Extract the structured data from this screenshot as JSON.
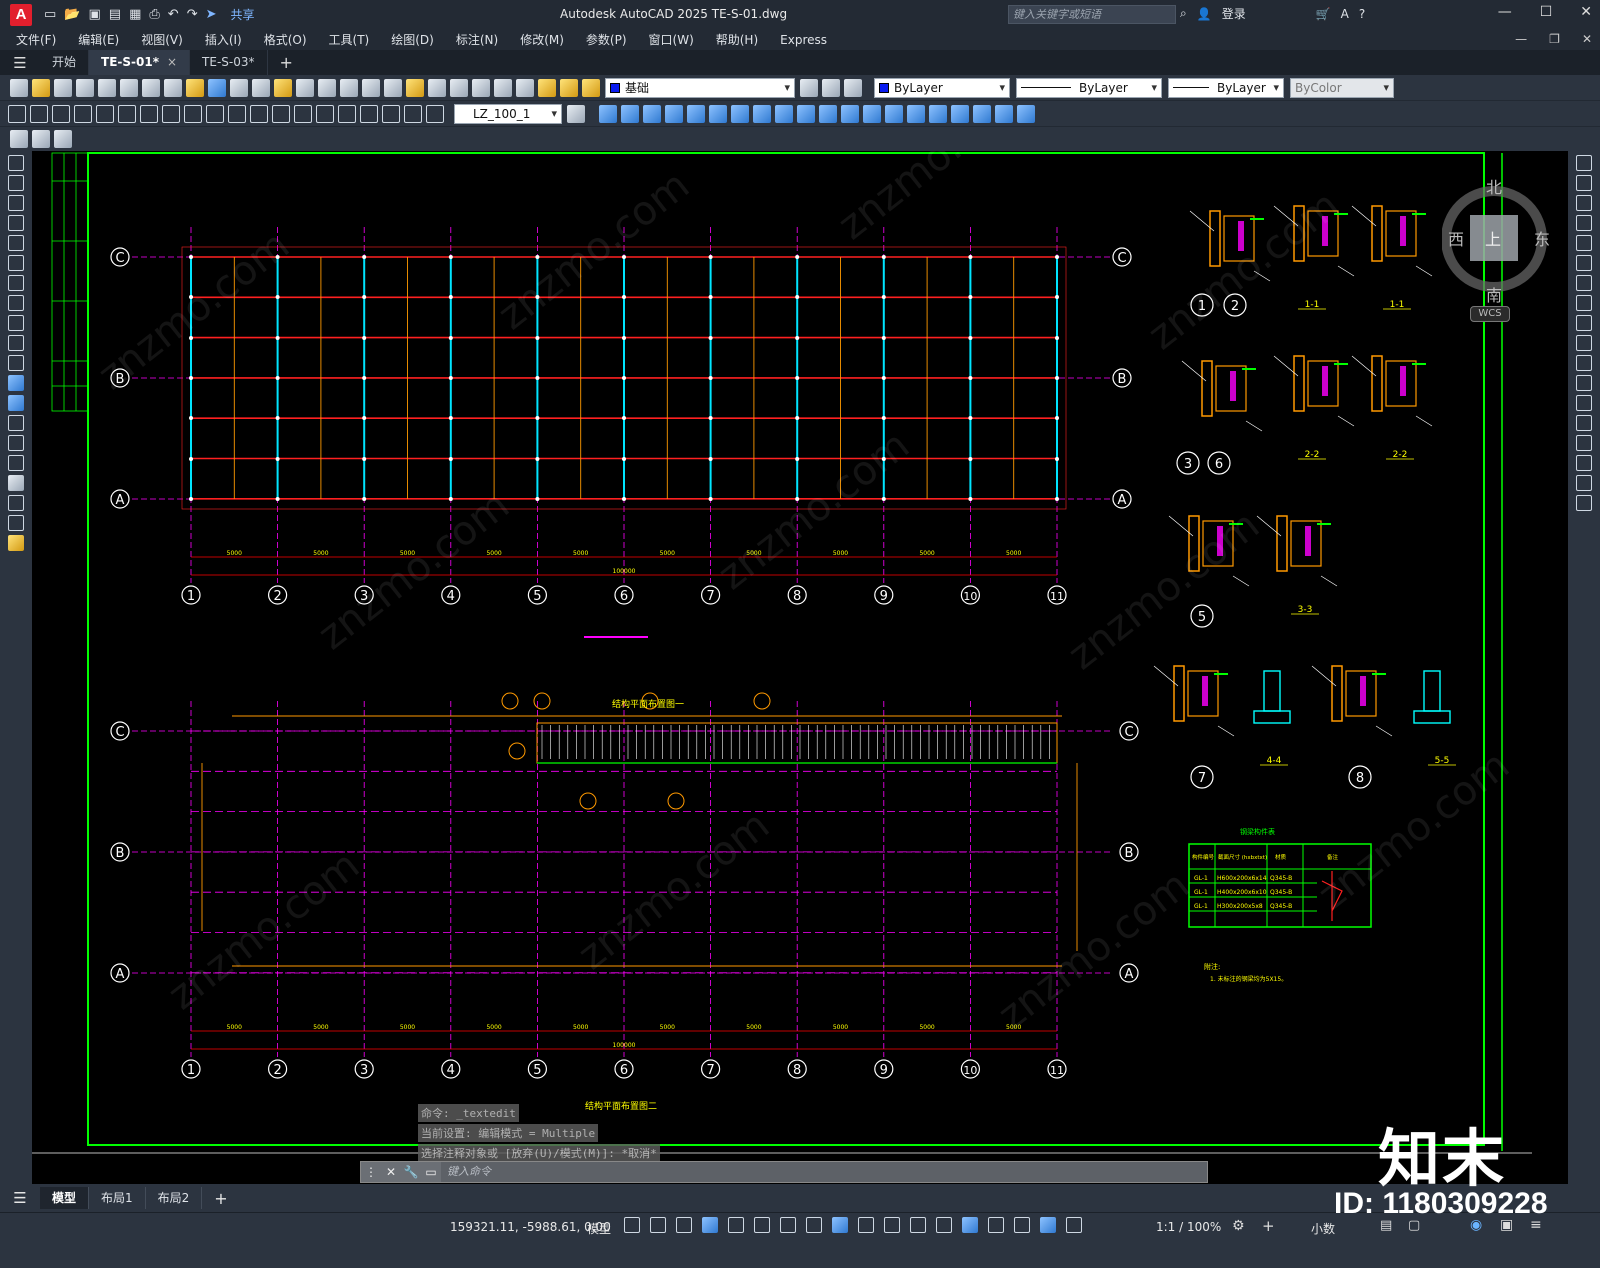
{
  "app": {
    "logo_letter": "A",
    "title": "Autodesk AutoCAD 2025    TE-S-01.dwg",
    "share_label": "共享",
    "search_placeholder": "键入关键字或短语",
    "login_label": "登录"
  },
  "menu": [
    "文件(F)",
    "编辑(E)",
    "视图(V)",
    "插入(I)",
    "格式(O)",
    "工具(T)",
    "绘图(D)",
    "标注(N)",
    "修改(M)",
    "参数(P)",
    "窗口(W)",
    "帮助(H)",
    "Express"
  ],
  "tabs": [
    {
      "label": "开始"
    },
    {
      "label": "TE-S-01*",
      "active": true,
      "close": "×"
    },
    {
      "label": "TE-S-03*"
    }
  ],
  "tab_add": "+",
  "toolbar": {
    "layer_name": "基础",
    "color": "ByLayer",
    "linetype": "ByLayer",
    "lineweight": "ByLayer",
    "plotstyle": "ByColor",
    "dimstyle": "LZ_100_1",
    "layer_swatch_color": "#0a1cf0"
  },
  "viewcube": {
    "north": "北",
    "south": "南",
    "east": "东",
    "west": "西",
    "top": "上",
    "wcs": "WCS"
  },
  "drawing": {
    "plan1_grid_rows": [
      "C",
      "B",
      "A"
    ],
    "plan2_grid_rows": [
      "C",
      "B",
      "A"
    ],
    "grid_cols": [
      "1",
      "2",
      "3",
      "4",
      "5",
      "6",
      "7",
      "8",
      "9",
      "10",
      "11"
    ],
    "plan2_title": "结构平面布置图一",
    "plan2_bottom_title": "结构平面布置图二",
    "detail_labels": [
      "1",
      "2",
      "3",
      "6",
      "5",
      "7",
      "8"
    ],
    "section_labels": [
      "1-1",
      "1-1",
      "2-2",
      "2-2",
      "3-3",
      "4-4",
      "5-5"
    ],
    "table_title": "钢梁构件表",
    "table_headers": [
      "构件编号",
      "截面尺寸 (hxbxtxt)",
      "材质",
      "备注"
    ],
    "table_rows": [
      [
        "GL-1",
        "H600x200x6x14",
        "Q345-B"
      ],
      [
        "GL-1",
        "H400x200x6x10",
        "Q345-B"
      ],
      [
        "GL-1",
        "H300x200x5x8",
        "Q345-B"
      ]
    ],
    "note_title": "附注:",
    "note_text": "1. 未标注的钢梁均为5X15。",
    "dims": [
      "5000",
      "5000",
      "5000",
      "5000",
      "5000",
      "5000",
      "5000",
      "5000",
      "5000",
      "5000"
    ],
    "total_dim": "100000"
  },
  "command": {
    "history": [
      "命令: _textedit",
      "当前设置: 编辑模式 = Multiple",
      "选择注释对象或 [放弃(U)/模式(M)]: *取消*"
    ],
    "placeholder": "键入命令"
  },
  "layout_tabs": [
    "模型",
    "布局1",
    "布局2"
  ],
  "status": {
    "coords": "159321.11, -5988.61, 0.00",
    "model": "模型",
    "scale": "1:1 / 100%",
    "units": "小数"
  },
  "watermark": {
    "logo": "知末",
    "id": "ID: 1180309228",
    "site": "znzmo.com"
  }
}
